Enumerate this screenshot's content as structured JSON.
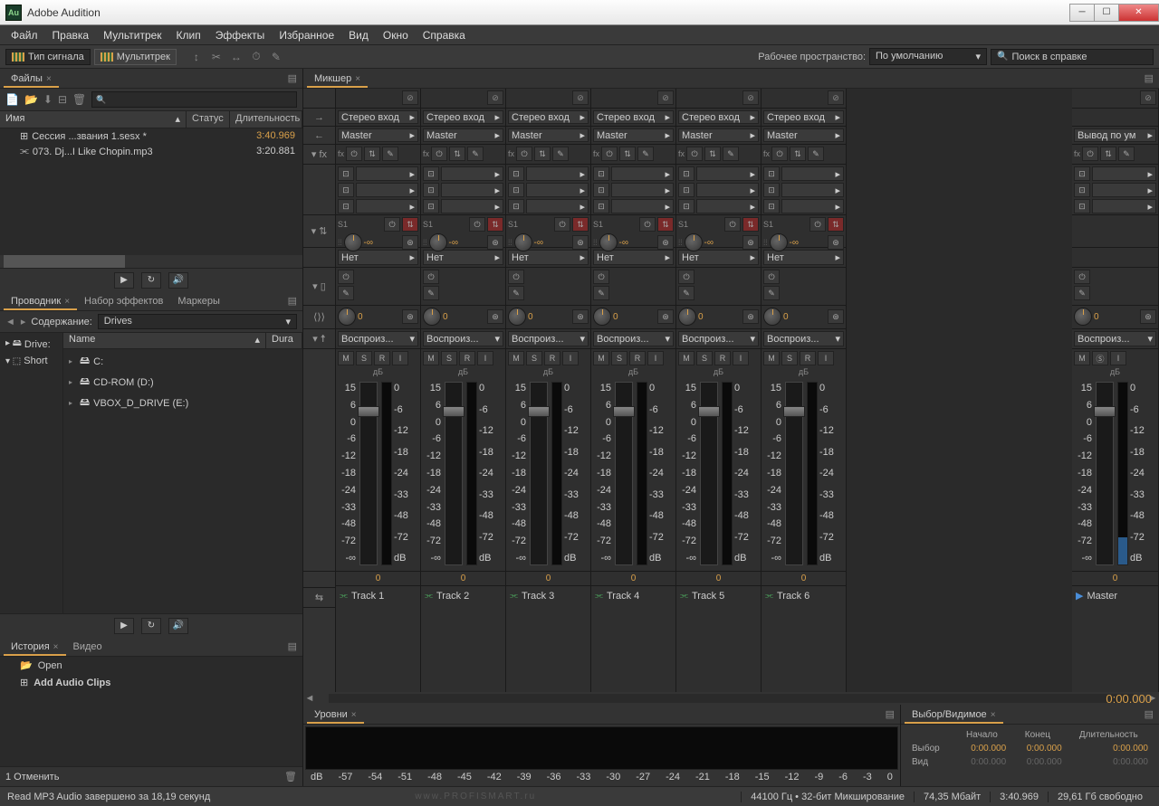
{
  "app": {
    "title": "Adobe Audition"
  },
  "menu": [
    "Файл",
    "Правка",
    "Мультитрек",
    "Клип",
    "Эффекты",
    "Избранное",
    "Вид",
    "Окно",
    "Справка"
  ],
  "viewbtns": {
    "signal": "Тип сигнала",
    "multitrack": "Мультитрек"
  },
  "workspace": {
    "label": "Рабочее пространство:",
    "value": "По умолчанию"
  },
  "search_placeholder": "Поиск в справке",
  "files": {
    "tab": "Файлы",
    "cols": {
      "name": "Имя",
      "status": "Статус",
      "dur": "Длительность"
    },
    "rows": [
      {
        "name": "Сессия ...звания 1.sesx *",
        "dur": "3:40.969",
        "dirty": true,
        "icon": "⊞"
      },
      {
        "name": "073. Dj...I Like Chopin.mp3",
        "dur": "3:20.881",
        "dirty": false,
        "icon": "⫘"
      }
    ]
  },
  "browser": {
    "tabs": [
      "Проводник",
      "Набор эффектов",
      "Маркеры"
    ],
    "content_label": "Содержание:",
    "content_value": "Drives",
    "left": [
      "Drive:",
      "Short"
    ],
    "cols": {
      "name": "Name",
      "dur": "Dura"
    },
    "nodes": [
      "C:",
      "CD-ROM (D:)",
      "VBOX_D_DRIVE (E:)"
    ]
  },
  "history": {
    "tabs": [
      "История",
      "Видео"
    ],
    "items": [
      "Open",
      "Add Audio Clips"
    ],
    "undo_label": "1 Отменить"
  },
  "mixer": {
    "tab": "Микшер",
    "stereo_in": "Стерео вход",
    "master": "Master",
    "output": "Вывод по ум",
    "none": "Нет",
    "play": "Воспроиз...",
    "db_label": "дБ",
    "fader_marks": [
      "15",
      "6",
      "0",
      "-6",
      "-12",
      "-18",
      "-24",
      "-33",
      "-48",
      "-72",
      "-∞"
    ],
    "meter_marks": [
      "0",
      "-6",
      "-12",
      "-18",
      "-24",
      "-33",
      "-48",
      "-72",
      "dB"
    ],
    "fader_val": "0",
    "pan_val": "0",
    "inf": "-∞",
    "send_labels": [
      "S1"
    ],
    "msr": [
      "M",
      "S",
      "R"
    ],
    "master_ms": [
      "M",
      "Ⓢ"
    ],
    "tracks": [
      "Track 1",
      "Track 2",
      "Track 3",
      "Track 4",
      "Track 5",
      "Track 6"
    ],
    "master_name": "Master",
    "time": "0:00.000"
  },
  "levels": {
    "tab": "Уровни",
    "marks": [
      "dB",
      "-57",
      "-54",
      "-51",
      "-48",
      "-45",
      "-42",
      "-39",
      "-36",
      "-33",
      "-30",
      "-27",
      "-24",
      "-21",
      "-18",
      "-15",
      "-12",
      "-9",
      "-6",
      "-3",
      "0"
    ]
  },
  "selection": {
    "tab": "Выбор/Видимое",
    "cols": [
      "Начало",
      "Конец",
      "Длительность"
    ],
    "rows": [
      {
        "label": "Выбор",
        "v": [
          "0:00.000",
          "0:00.000",
          "0:00.000"
        ],
        "bright": true
      },
      {
        "label": "Вид",
        "v": [
          "0:00.000",
          "0:00.000",
          "0:00.000"
        ],
        "bright": false
      }
    ]
  },
  "status": {
    "msg": "Read MP3 Audio завершено за 18,19 секунд",
    "rate": "44100 Гц • 32-бит Микширование",
    "mem": "74,35 Мбайт",
    "dur": "3:40.969",
    "free": "29,61 Гб свободно"
  },
  "watermark": "www.PROFISMART.ru"
}
